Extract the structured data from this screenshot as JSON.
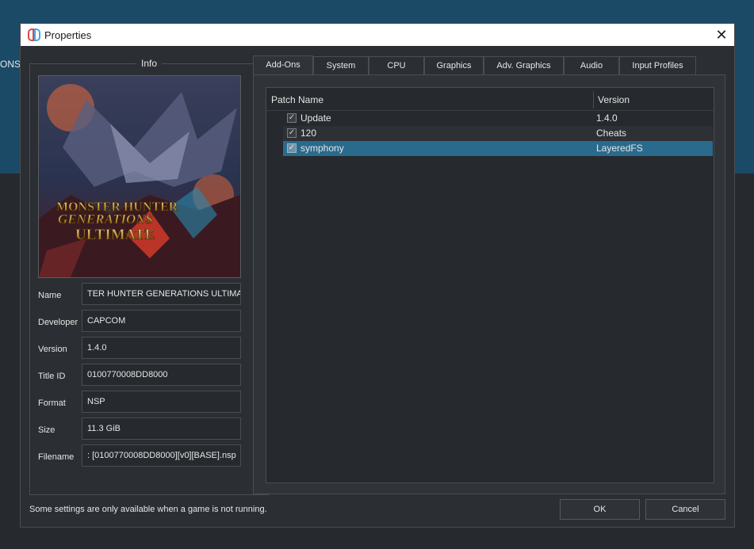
{
  "background": {
    "partial_text": "ONS"
  },
  "dialog": {
    "title": "Properties",
    "close_glyph": "✕",
    "icons": [
      "app-logo-icon",
      "close-icon"
    ]
  },
  "info": {
    "legend": "Info",
    "cover_title_lines": [
      "MONSTER HUNTER",
      "GENERATIONS",
      "ULTIMATE"
    ],
    "fields": {
      "name": {
        "label": "Name",
        "value": "TER HUNTER GENERATIONS ULTIMATE"
      },
      "developer": {
        "label": "Developer",
        "value": "CAPCOM"
      },
      "version": {
        "label": "Version",
        "value": "1.4.0"
      },
      "title_id": {
        "label": "Title ID",
        "value": "0100770008DD8000"
      },
      "format": {
        "label": "Format",
        "value": "NSP"
      },
      "size": {
        "label": "Size",
        "value": "11.3 GiB"
      },
      "filename": {
        "label": "Filename",
        "value": ": [0100770008DD8000][v0][BASE].nsp"
      }
    }
  },
  "tabs": [
    "Add-Ons",
    "System",
    "CPU",
    "Graphics",
    "Adv. Graphics",
    "Audio",
    "Input Profiles"
  ],
  "active_tab": "Add-Ons",
  "addons": {
    "columns": [
      "Patch Name",
      "Version"
    ],
    "check_glyph": "✓",
    "rows": [
      {
        "name": "Update",
        "version": "1.4.0",
        "checked": true,
        "selected": false
      },
      {
        "name": "120",
        "version": "Cheats",
        "checked": true,
        "selected": false
      },
      {
        "name": "symphony",
        "version": "LayeredFS",
        "checked": true,
        "selected": true
      }
    ]
  },
  "footer": {
    "note": "Some settings are only available when a game is not running.",
    "ok_label": "OK",
    "cancel_label": "Cancel"
  },
  "colors": {
    "title_bg": "#ffffff",
    "dialog_bg": "#2b2e32",
    "selection": "#2a6a8d",
    "top_band": "#1b4a66",
    "logo_red": "#e84545",
    "logo_blue": "#4aa3e0"
  }
}
